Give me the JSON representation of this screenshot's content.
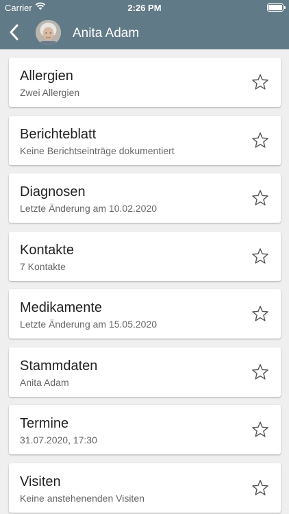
{
  "status_bar": {
    "carrier": "Carrier",
    "time": "2:26 PM"
  },
  "header": {
    "title": "Anita Adam",
    "back_icon": "chevron-left-icon",
    "avatar": "patient-photo"
  },
  "colors": {
    "header_bg": "#617a87",
    "background": "#efefef",
    "card_bg": "#ffffff"
  },
  "items": [
    {
      "label": "Allergien",
      "subtitle": "Zwei Allergien",
      "favorite": false
    },
    {
      "label": "Berichteblatt",
      "subtitle": "Keine Berichtseinträge dokumentiert",
      "favorite": false
    },
    {
      "label": "Diagnosen",
      "subtitle": "Letzte Änderung am 10.02.2020",
      "favorite": false
    },
    {
      "label": "Kontakte",
      "subtitle": "7 Kontakte",
      "favorite": false
    },
    {
      "label": "Medikamente",
      "subtitle": "Letzte Änderung am 15.05.2020",
      "favorite": false
    },
    {
      "label": "Stammdaten",
      "subtitle": "Anita Adam",
      "favorite": false
    },
    {
      "label": "Termine",
      "subtitle": "31.07.2020, 17:30",
      "favorite": false
    },
    {
      "label": "Visiten",
      "subtitle": "Keine anstehenenden Visiten",
      "favorite": false
    }
  ]
}
